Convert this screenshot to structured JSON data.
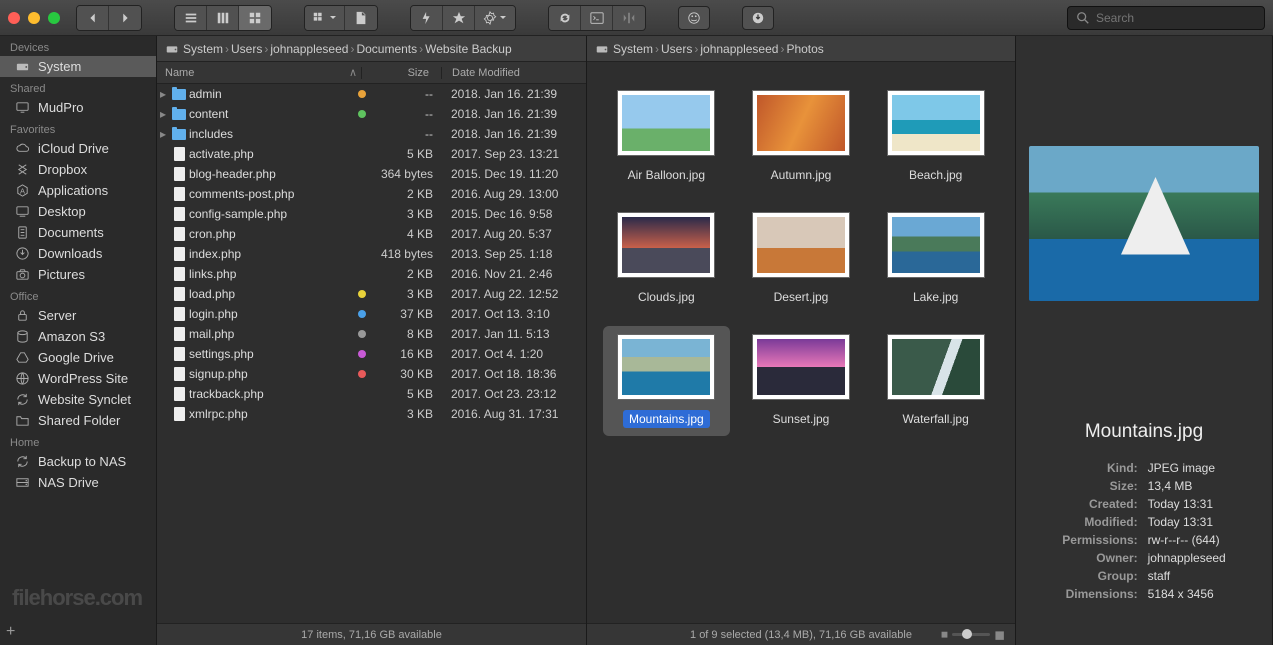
{
  "search": {
    "placeholder": "Search"
  },
  "sidebar": {
    "s0": {
      "title": "Devices",
      "items": [
        {
          "label": "System",
          "sel": true,
          "icon": "hdd"
        }
      ]
    },
    "s1": {
      "title": "Shared",
      "items": [
        {
          "label": "MudPro",
          "icon": "monitor"
        }
      ]
    },
    "s2": {
      "title": "Favorites",
      "items": [
        {
          "label": "iCloud Drive",
          "icon": "cloud"
        },
        {
          "label": "Dropbox",
          "icon": "dropbox"
        },
        {
          "label": "Applications",
          "icon": "apps"
        },
        {
          "label": "Desktop",
          "icon": "desktop"
        },
        {
          "label": "Documents",
          "icon": "docs"
        },
        {
          "label": "Downloads",
          "icon": "download"
        },
        {
          "label": "Pictures",
          "icon": "camera"
        }
      ]
    },
    "s3": {
      "title": "Office",
      "items": [
        {
          "label": "Server",
          "icon": "lock"
        },
        {
          "label": "Amazon S3",
          "icon": "s3"
        },
        {
          "label": "Google Drive",
          "icon": "gdrive"
        },
        {
          "label": "WordPress Site",
          "icon": "globe"
        },
        {
          "label": "Website Synclet",
          "icon": "sync"
        },
        {
          "label": "Shared Folder",
          "icon": "folder"
        }
      ]
    },
    "s4": {
      "title": "Home",
      "items": [
        {
          "label": "Backup to NAS",
          "icon": "sync"
        },
        {
          "label": "NAS Drive",
          "icon": "drive"
        }
      ]
    }
  },
  "paneA": {
    "path": [
      "System",
      "Users",
      "johnappleseed",
      "Documents",
      "Website Backup"
    ],
    "cols": {
      "name": "Name",
      "size": "Size",
      "date": "Date Modified"
    },
    "rows": [
      {
        "name": "admin",
        "kind": "folder",
        "size": "--",
        "date": "2018. Jan 16. 21:39",
        "tag": "#e8a23a",
        "exp": true
      },
      {
        "name": "content",
        "kind": "folder",
        "size": "--",
        "date": "2018. Jan 16. 21:39",
        "tag": "#5fc35f",
        "exp": true
      },
      {
        "name": "includes",
        "kind": "folder",
        "size": "--",
        "date": "2018. Jan 16. 21:39",
        "exp": true
      },
      {
        "name": "activate.php",
        "kind": "file",
        "size": "5 KB",
        "date": "2017. Sep 23. 13:21"
      },
      {
        "name": "blog-header.php",
        "kind": "file",
        "size": "364 bytes",
        "date": "2015. Dec 19. 11:20"
      },
      {
        "name": "comments-post.php",
        "kind": "file",
        "size": "2 KB",
        "date": "2016. Aug 29. 13:00"
      },
      {
        "name": "config-sample.php",
        "kind": "file",
        "size": "3 KB",
        "date": "2015. Dec 16. 9:58"
      },
      {
        "name": "cron.php",
        "kind": "file",
        "size": "4 KB",
        "date": "2017. Aug 20. 5:37"
      },
      {
        "name": "index.php",
        "kind": "file",
        "size": "418 bytes",
        "date": "2013. Sep 25. 1:18"
      },
      {
        "name": "links.php",
        "kind": "file",
        "size": "2 KB",
        "date": "2016. Nov 21. 2:46"
      },
      {
        "name": "load.php",
        "kind": "file",
        "size": "3 KB",
        "date": "2017. Aug 22. 12:52",
        "tag": "#e8d23a"
      },
      {
        "name": "login.php",
        "kind": "file",
        "size": "37 KB",
        "date": "2017. Oct 13. 3:10",
        "tag": "#4aa0e8"
      },
      {
        "name": "mail.php",
        "kind": "file",
        "size": "8 KB",
        "date": "2017. Jan 11. 5:13",
        "tag": "#999"
      },
      {
        "name": "settings.php",
        "kind": "file",
        "size": "16 KB",
        "date": "2017. Oct 4. 1:20",
        "tag": "#c85ad6"
      },
      {
        "name": "signup.php",
        "kind": "file",
        "size": "30 KB",
        "date": "2017. Oct 18. 18:36",
        "tag": "#e85a5a"
      },
      {
        "name": "trackback.php",
        "kind": "file",
        "size": "5 KB",
        "date": "2017. Oct 23. 23:12"
      },
      {
        "name": "xmlrpc.php",
        "kind": "file",
        "size": "3 KB",
        "date": "2016. Aug 31. 17:31"
      }
    ],
    "status": "17 items, 71,16 GB available"
  },
  "paneB": {
    "path": [
      "System",
      "Users",
      "johnappleseed",
      "Photos"
    ],
    "thumbs": [
      {
        "name": "Air Balloon.jpg",
        "bg": "linear-gradient(#96c9ed 60%,#6ab06a 60%)"
      },
      {
        "name": "Autumn.jpg",
        "bg": "linear-gradient(115deg,#c0572a,#e8923a,#c0572a)"
      },
      {
        "name": "Beach.jpg",
        "bg": "linear-gradient(#7ec8e8 45%,#1f9bb8 45% 70%,#efe6c8 70%)"
      },
      {
        "name": "Clouds.jpg",
        "bg": "linear-gradient(#2a2a4a,#c8604a 55%,#4a4a5a 55%)"
      },
      {
        "name": "Desert.jpg",
        "bg": "linear-gradient(#d8c8b8 55%,#c87838 55%)"
      },
      {
        "name": "Lake.jpg",
        "bg": "linear-gradient(#6aa8d4 35%,#4a7a5a 35% 62%,#2a6898 62%)"
      },
      {
        "name": "Mountains.jpg",
        "bg": "linear-gradient(#7ab4d4 32%,#a8b898 32% 58%,#1f7aa8 58%)",
        "sel": true
      },
      {
        "name": "Sunset.jpg",
        "bg": "linear-gradient(#7a3a98,#e878b8 50%,#2a2a3a 50%)"
      },
      {
        "name": "Waterfall.jpg",
        "bg": "linear-gradient(110deg,#3a5a4a 55%,#d8e4e8 55% 65%,#2a4a3a 65%)"
      }
    ],
    "status": "1 of 9 selected (13,4 MB), 71,16 GB available"
  },
  "preview": {
    "title": "Mountains.jpg",
    "meta": [
      {
        "k": "Kind:",
        "v": "JPEG image"
      },
      {
        "k": "Size:",
        "v": "13,4 MB"
      },
      {
        "k": "Created:",
        "v": "Today 13:31"
      },
      {
        "k": "Modified:",
        "v": "Today 13:31"
      },
      {
        "k": "Permissions:",
        "v": "rw-r--r-- (644)"
      },
      {
        "k": "Owner:",
        "v": "johnappleseed"
      },
      {
        "k": "Group:",
        "v": "staff"
      },
      {
        "k": "Dimensions:",
        "v": "5184 x 3456"
      }
    ]
  },
  "watermark": "filehorse.com"
}
